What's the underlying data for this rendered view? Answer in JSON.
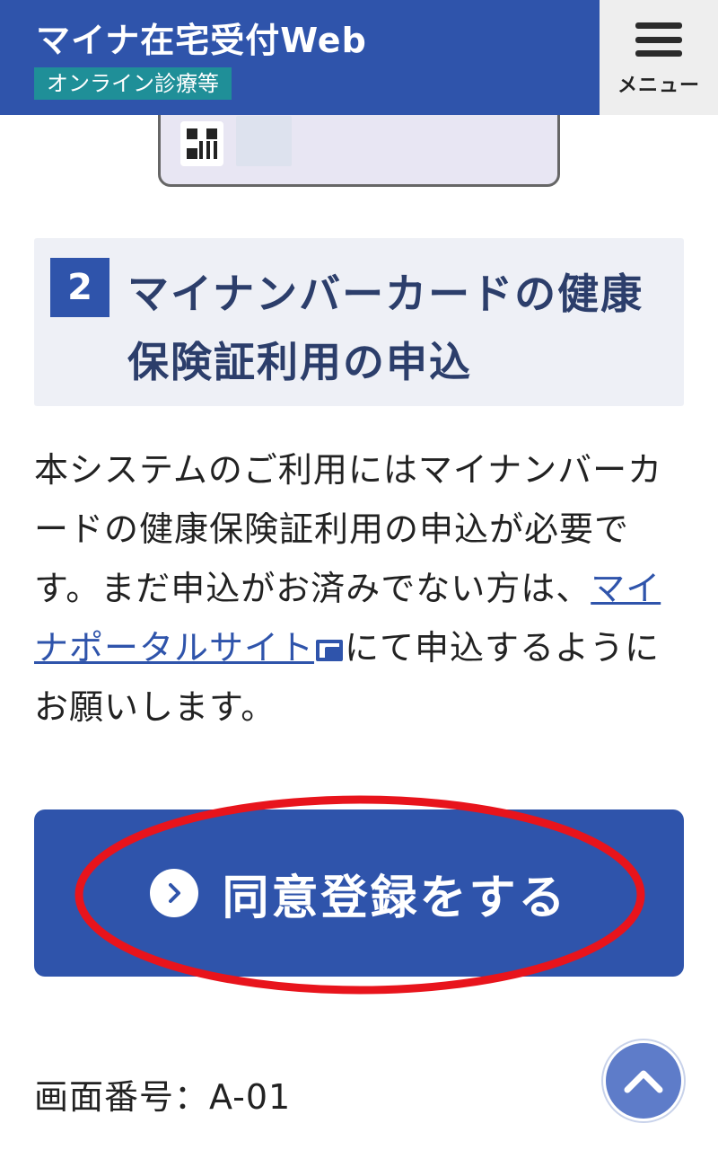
{
  "header": {
    "app_title": "マイナ在宅受付Web",
    "app_subtitle": "オンライン診療等",
    "menu_label": "メニュー"
  },
  "section": {
    "step_number": "2",
    "title": "マイナンバーカードの健康保険証利用の申込"
  },
  "body": {
    "text_before_link": "本システムのご利用にはマイナンバーカードの健康保険証利用の申込が必要です。まだ申込がお済みでない方は、",
    "link_text": "マイナポータルサイト",
    "link_icon": "external-link-icon",
    "text_after_link": "にて申込するようにお願いします。"
  },
  "consent_button": {
    "label": "同意登録をする",
    "icon": "chevron-right-circle-icon"
  },
  "footer": {
    "screen_id": "画面番号：A-01",
    "scroll_top_icon": "chevron-up-icon"
  },
  "colors": {
    "primary": "#2f54ab",
    "subtitle_bg": "#1f8f98",
    "section_bg": "#eef0f6",
    "annotation_red": "#e8141c"
  }
}
